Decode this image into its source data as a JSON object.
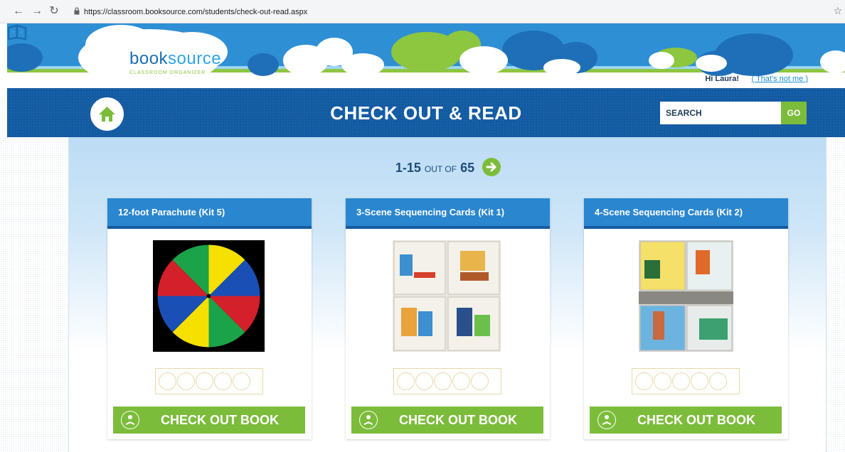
{
  "browser": {
    "url": "https://classroom.booksource.com/students/check-out-read.aspx"
  },
  "brand": {
    "name_part1": "book",
    "name_part2": "source",
    "tagline": "CLASSROOM ORGANIZER"
  },
  "user": {
    "greeting": "Hi Laura!",
    "not_me": "( That's not me )"
  },
  "header": {
    "title": "CHECK OUT & READ",
    "search_placeholder": "SEARCH",
    "go_label": "GO"
  },
  "pager": {
    "range": "1-15",
    "out_of": "OUT OF",
    "total": "65"
  },
  "books": [
    {
      "title": "12-foot Parachute (Kit 5)",
      "rating": 0,
      "action": "CHECK OUT BOOK"
    },
    {
      "title": "3-Scene Sequencing Cards (Kit 1)",
      "rating": 0,
      "action": "CHECK OUT BOOK"
    },
    {
      "title": "4-Scene Sequencing Cards (Kit 2)",
      "rating": 0,
      "action": "CHECK OUT BOOK"
    }
  ],
  "colors": {
    "primary_blue": "#145aa0",
    "card_header_blue": "#2a86cf",
    "accent_green": "#7cbc3b"
  }
}
